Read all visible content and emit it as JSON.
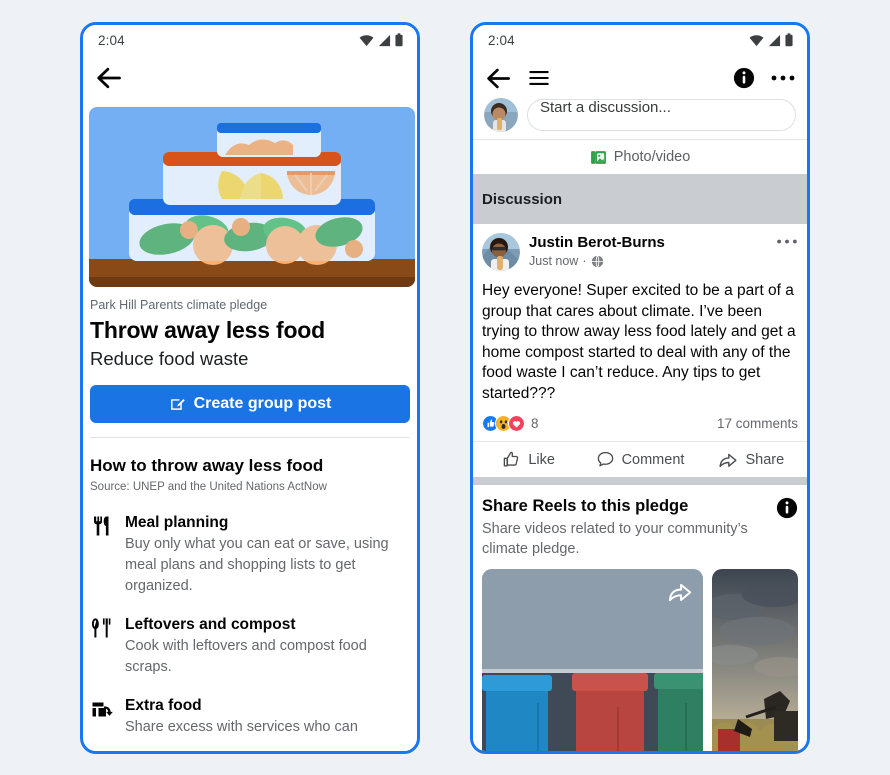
{
  "theme": {
    "page_bg": "#eef2f7",
    "frame_border": "#1877f2",
    "accent_blue": "#1b74e4",
    "text_primary": "#050505",
    "text_secondary": "#65676b",
    "section_gray": "#c9ccd1"
  },
  "left_phone": {
    "status_bar": {
      "time": "2:04",
      "icons": [
        "wifi-icon",
        "cellular-signal-icon",
        "battery-icon"
      ]
    },
    "nav": {
      "back_icon": "back-arrow-icon"
    },
    "hero": {
      "alt": "illustration of stacked food storage containers with fruit and greens"
    },
    "eyebrow": "Park Hill Parents climate pledge",
    "title": "Throw away less food",
    "subtitle": "Reduce food waste",
    "cta": {
      "label": "Create group post",
      "icon": "compose-square-icon"
    },
    "howto": {
      "title": "How to throw away less food",
      "source": "Source: UNEP and the United Nations ActNow",
      "tips": [
        {
          "icon": "fork-and-knife-icon",
          "heading": "Meal planning",
          "body": "Buy only what you can eat or save, using meal plans and shopping lists to get organized."
        },
        {
          "icon": "whisk-and-spatula-icon",
          "heading": "Leftovers and compost",
          "body": "Cook with leftovers and compost food scraps."
        },
        {
          "icon": "food-share-box-icon",
          "heading": "Extra food",
          "body": "Share excess with services who can"
        }
      ]
    }
  },
  "right_phone": {
    "status_bar": {
      "time": "2:04",
      "icons": [
        "wifi-icon",
        "cellular-signal-icon",
        "battery-icon"
      ]
    },
    "nav": {
      "back_icon": "back-arrow-icon",
      "menu_icon": "hamburger-menu-icon",
      "info_icon": "info-circle-icon",
      "more_icon": "more-horizontal-icon"
    },
    "composer": {
      "avatar": "user-avatar",
      "placeholder": "Start a discussion...",
      "photo_video_label": "Photo/video",
      "photo_video_icon": "photo-video-icon"
    },
    "section_header": "Discussion",
    "post": {
      "avatar": "author-avatar",
      "author": "Justin Berot-Burns",
      "timestamp": "Just now",
      "audience_icon": "globe-icon",
      "more_icon": "more-horizontal-icon",
      "body": "Hey everyone! Super excited to be a part of a group that cares about climate. I’ve been trying to throw away less food lately and get a home compost started to deal with any of the food waste I can’t reduce. Any tips to get started???",
      "reactions": [
        "like",
        "wow",
        "love"
      ],
      "reaction_count": "8",
      "comment_count": "17 comments",
      "actions": [
        {
          "label": "Like",
          "icon": "thumbs-up-icon"
        },
        {
          "label": "Comment",
          "icon": "comment-bubble-icon"
        },
        {
          "label": "Share",
          "icon": "share-arrow-icon"
        }
      ]
    },
    "reels": {
      "title": "Share Reels to this pledge",
      "subtitle": "Share videos related to your community’s climate pledge.",
      "info_icon": "info-circle-icon",
      "items": [
        {
          "alt": "blue red and green wheelie bins against a grey wall",
          "share_icon": "share-arrow-icon"
        },
        {
          "alt": "farm machinery under a dramatic cloudy sky"
        }
      ]
    }
  }
}
